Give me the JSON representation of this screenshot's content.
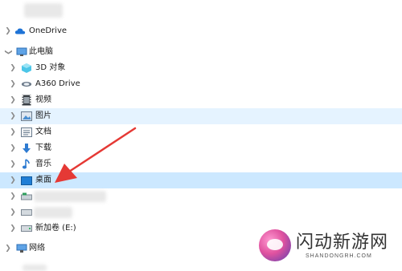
{
  "nav": {
    "onedrive": "OneDrive",
    "this_pc": "此电脑",
    "items": [
      {
        "label": "3D 对象",
        "icon": "3d-objects-icon"
      },
      {
        "label": "A360 Drive",
        "icon": "a360-drive-icon"
      },
      {
        "label": "视频",
        "icon": "videos-icon"
      },
      {
        "label": "图片",
        "icon": "pictures-icon"
      },
      {
        "label": "文档",
        "icon": "documents-icon"
      },
      {
        "label": "下载",
        "icon": "downloads-icon"
      },
      {
        "label": "音乐",
        "icon": "music-icon"
      },
      {
        "label": "桌面",
        "icon": "desktop-icon"
      }
    ],
    "new_volume": "新加卷 (E:)",
    "network": "网络"
  },
  "watermark": {
    "cn": "闪动新游网",
    "en": "SHANDONGRH.COM"
  },
  "colors": {
    "selected": "#cce8ff",
    "hover": "#e5f3ff",
    "arrow": "#e53935"
  }
}
